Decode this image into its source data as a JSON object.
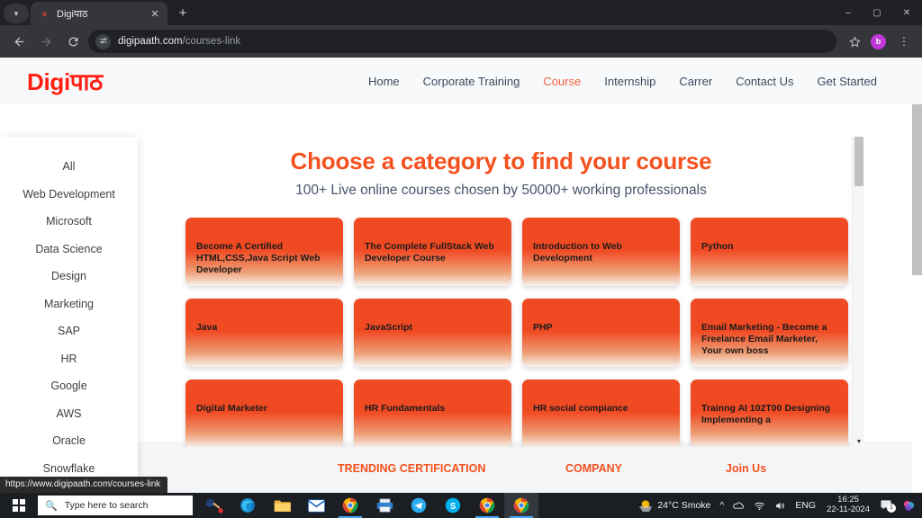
{
  "browser": {
    "tab": {
      "title": "Digiपाठ",
      "favicon_icon": "digipaath-favicon",
      "close_icon": "close-icon"
    },
    "tab_search_icon": "chevron-down-icon",
    "new_tab_icon": "plus-icon",
    "window_controls": {
      "minimize": "–",
      "maximize": "▢",
      "close": "✕"
    },
    "nav": {
      "back_icon": "arrow-left-icon",
      "forward_icon": "arrow-right-icon",
      "reload_icon": "reload-icon"
    },
    "omnibox": {
      "site_settings_icon": "tune-icon",
      "domain": "digipaath.com",
      "path": "/courses-link"
    },
    "bookmark_icon": "star-icon",
    "profile_initial": "b",
    "menu_icon": "three-dots-icon",
    "status_bubble": "https://www.digipaath.com/courses-link"
  },
  "site": {
    "logo": "Digiपाठ",
    "nav_links": [
      {
        "label": "Home",
        "active": false
      },
      {
        "label": "Corporate Training",
        "active": false
      },
      {
        "label": "Course",
        "active": true
      },
      {
        "label": "Internship",
        "active": false
      },
      {
        "label": "Carrer",
        "active": false
      },
      {
        "label": "Contact Us",
        "active": false
      },
      {
        "label": "Get Started",
        "active": false
      }
    ],
    "sidebar": {
      "items": [
        "All",
        "Web Development",
        "Microsoft",
        "Data Science",
        "Design",
        "Marketing",
        "SAP",
        "HR",
        "Google",
        "AWS",
        "Oracle",
        "Snowflake"
      ]
    },
    "main": {
      "title": "Choose a category to find your course",
      "subtitle": "100+ Live online courses chosen by 50000+ working professionals",
      "cards": [
        "Become A Certified HTML,CSS,Java Script Web Developer",
        "The Complete FullStack Web Developer Course",
        "Introduction to Web Development",
        "Python",
        "Java",
        "JavaScript",
        "PHP",
        "Email Marketing - Become a Freelance Email Marketer, Your own boss",
        "Digital Marketer",
        "HR Fundamentals",
        "HR social compiance",
        "Trainng AI 102T00 Designing Implementing a"
      ]
    },
    "footer": {
      "col1": "TRENDING CERTIFICATION",
      "col2": "COMPANY",
      "col3": "Join Us"
    },
    "colors": {
      "brand_red": "#ff1e10",
      "accent_orange": "#f4511e",
      "card_orange": "#f04a23",
      "nav_text": "#3a4a5c"
    }
  },
  "taskbar": {
    "start_icon": "windows-start-icon",
    "search_placeholder": "Type here to search",
    "search_icon": "search-icon",
    "widget_icon": "cricket-widget-icon",
    "apps": [
      "edge-icon",
      "file-explorer-icon",
      "mail-icon",
      "chrome-icon",
      "printer-icon",
      "telegram-icon",
      "skype-icon",
      "chrome-icon",
      "chrome-active-icon"
    ],
    "tray": {
      "weather": "24°C  Smoke",
      "overflow_icon": "chevron-up-icon",
      "onedrive_icon": "onedrive-icon",
      "network_icon": "wifi-icon",
      "volume_icon": "volume-icon",
      "language": "ENG",
      "time": "16:25",
      "date": "22-11-2024",
      "notification_icon": "notification-icon",
      "notification_count": "1"
    }
  }
}
